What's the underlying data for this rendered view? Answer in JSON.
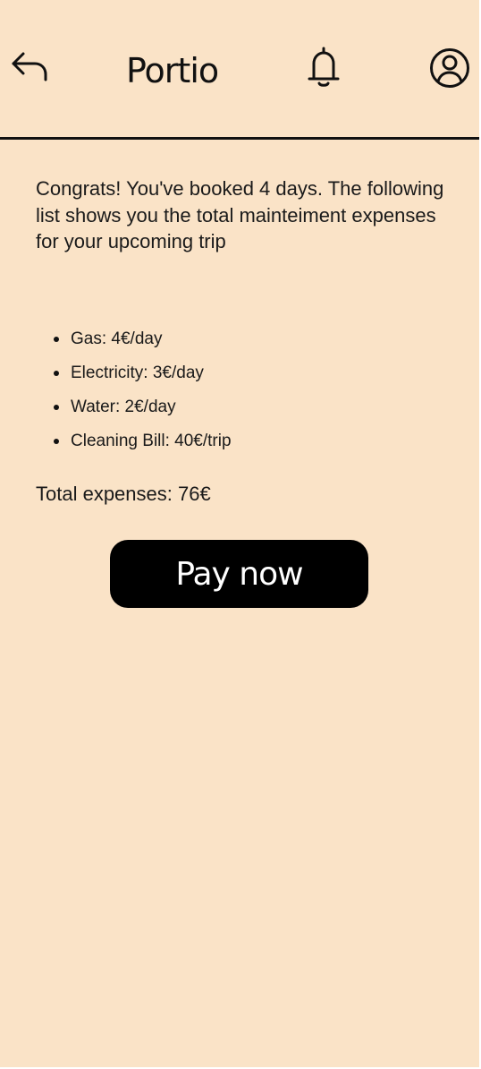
{
  "header": {
    "title": "Portio",
    "back_icon": "back-arrow-icon",
    "notification_icon": "bell-icon",
    "profile_icon": "user-profile-icon"
  },
  "main": {
    "intro_text": "Congrats! You've booked 4 days. The following list shows you the total mainteiment expenses for your upcoming trip",
    "expenses": [
      {
        "label": "Gas: 4€/day"
      },
      {
        "label": "Electricity: 3€/day"
      },
      {
        "label": "Water: 2€/day"
      },
      {
        "label": "Cleaning Bill: 40€/trip"
      }
    ],
    "total_text": "Total expenses: 76€",
    "pay_button_label": "Pay now"
  },
  "colors": {
    "background": "#fae3c7",
    "primary": "#000000",
    "button_text": "#ffffff"
  }
}
